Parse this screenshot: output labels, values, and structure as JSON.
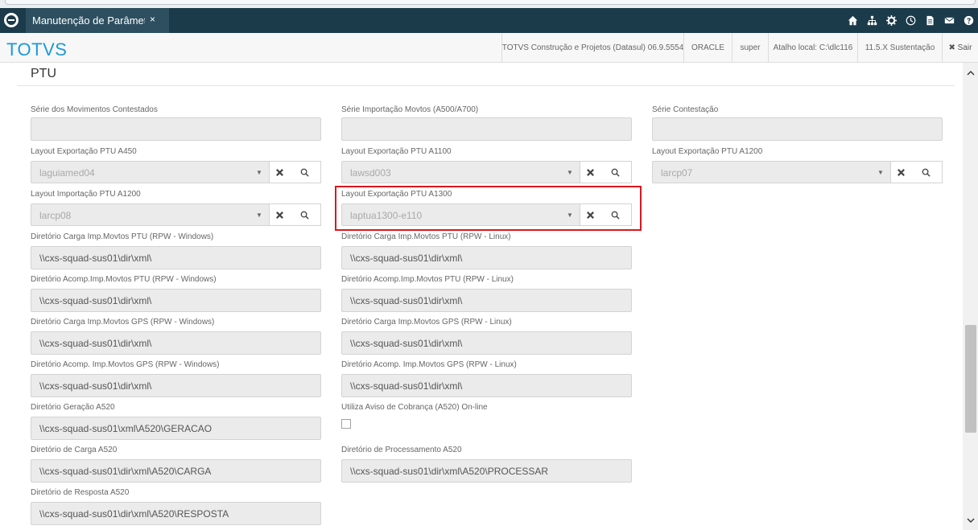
{
  "tab": {
    "title": "Manutenção de Parâmetros",
    "close": "×"
  },
  "top_icons": [
    "home-icon",
    "sitemap-icon",
    "settings-icon",
    "clock-icon",
    "document-icon",
    "mail-icon",
    "help-icon"
  ],
  "header": {
    "brand": "TOTVS",
    "company": "TOTVS Construção e Projetos (Datasul) 06.9.5554",
    "database": "ORACLE",
    "user": "super",
    "shortcut": "Atalho local: C:\\dlc116",
    "version": "11.5.X Sustentação",
    "exit": "✖ Sair"
  },
  "section": {
    "title": "PTU"
  },
  "fields": {
    "serie_mov_contestados": {
      "label": "Série dos Movimentos Contestados",
      "value": ""
    },
    "serie_import_movtos": {
      "label": "Série Importação Movtos (A500/A700)",
      "value": ""
    },
    "serie_contestacao": {
      "label": "Série Contestação",
      "value": ""
    },
    "layout_exp_a450": {
      "label": "Layout Exportação PTU A450",
      "value": "laguiamed04"
    },
    "layout_exp_a1100": {
      "label": "Layout Exportação PTU A1100",
      "value": "lawsd003"
    },
    "layout_exp_a1200": {
      "label": "Layout Exportação PTU A1200",
      "value": "larcp07"
    },
    "layout_imp_a1200": {
      "label": "Layout Importação PTU A1200",
      "value": "larcp08"
    },
    "layout_exp_a1300": {
      "label": "Layout Exportação PTU A1300",
      "value": "laptua1300-e110"
    },
    "dir_carga_ptu_win": {
      "label": "Diretório Carga Imp.Movtos PTU (RPW - Windows)",
      "value": "\\\\cxs-squad-sus01\\dir\\xml\\"
    },
    "dir_carga_ptu_linux": {
      "label": "Diretório Carga Imp.Movtos PTU (RPW - Linux)",
      "value": "\\\\cxs-squad-sus01\\dir\\xml\\"
    },
    "dir_acomp_ptu_win": {
      "label": "Diretório Acomp.Imp.Movtos PTU (RPW - Windows)",
      "value": "\\\\cxs-squad-sus01\\dir\\xml\\"
    },
    "dir_acomp_ptu_linux": {
      "label": "Diretório Acomp.Imp.Movtos PTU (RPW - Linux)",
      "value": "\\\\cxs-squad-sus01\\dir\\xml\\"
    },
    "dir_carga_gps_win": {
      "label": "Diretório Carga Imp.Movtos GPS (RPW - Windows)",
      "value": "\\\\cxs-squad-sus01\\dir\\xml\\"
    },
    "dir_carga_gps_linux": {
      "label": "Diretório Carga Imp.Movtos GPS (RPW - Linux)",
      "value": "\\\\cxs-squad-sus01\\dir\\xml\\"
    },
    "dir_acomp_gps_win": {
      "label": "Diretório Acomp. Imp.Movtos GPS (RPW - Windows)",
      "value": "\\\\cxs-squad-sus01\\dir\\xml\\"
    },
    "dir_acomp_gps_linux": {
      "label": "Diretório Acomp. Imp.Movtos GPS (RPW - Linux)",
      "value": "\\\\cxs-squad-sus01\\dir\\xml\\"
    },
    "dir_geracao_a520": {
      "label": "Diretório Geração A520",
      "value": "\\\\cxs-squad-sus01\\xml\\A520\\GERACAO"
    },
    "aviso_cobranca_a520": {
      "label": "Utiliza Aviso de Cobrança (A520) On-line",
      "checked": false
    },
    "dir_carga_a520": {
      "label": "Diretório de Carga A520",
      "value": "\\\\cxs-squad-sus01\\dir\\xml\\A520\\CARGA"
    },
    "dir_processamento_a520": {
      "label": "Diretório de Processamento A520",
      "value": "\\\\cxs-squad-sus01\\dir\\xml\\A520\\PROCESSAR"
    },
    "dir_resposta_a520": {
      "label": "Diretório de Resposta A520",
      "value": "\\\\cxs-squad-sus01\\dir\\xml\\A520\\RESPOSTA"
    }
  },
  "colors": {
    "topbar": "#1b3a4a",
    "brand": "#1b9ad6",
    "highlight": "#d9181f"
  }
}
